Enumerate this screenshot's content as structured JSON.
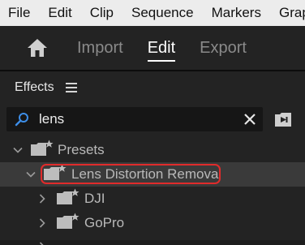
{
  "menubar": {
    "items": [
      "File",
      "Edit",
      "Clip",
      "Sequence",
      "Markers",
      "Grap"
    ]
  },
  "workspace": {
    "home_icon": "home-icon",
    "tabs": [
      {
        "label": "Import",
        "active": false
      },
      {
        "label": "Edit",
        "active": true
      },
      {
        "label": "Export",
        "active": false
      }
    ]
  },
  "effects_panel": {
    "title": "Effects",
    "menu_icon": "hamburger-menu-icon",
    "search": {
      "value": "lens",
      "placeholder": "",
      "search_icon": "search-icon",
      "clear_icon": "close-icon"
    },
    "new_bin_icon": "new-custom-bin-icon",
    "tree": [
      {
        "label": "Presets",
        "level": 0,
        "expanded": true,
        "selected": false
      },
      {
        "label": "Lens Distortion Removal",
        "level": 1,
        "expanded": true,
        "selected": true,
        "annotated": true
      },
      {
        "label": "DJI",
        "level": 2,
        "expanded": false,
        "selected": false
      },
      {
        "label": "GoPro",
        "level": 2,
        "expanded": false,
        "selected": false
      }
    ]
  },
  "colors": {
    "accent_active_tab": "#ffffff",
    "search_icon": "#3d8ee8",
    "annotation": "#e12b2b",
    "selected_row": "#3a3a3a"
  }
}
